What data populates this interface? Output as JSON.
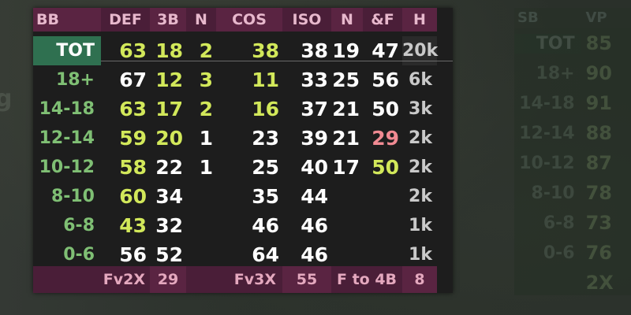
{
  "header": [
    "BB",
    "DEF",
    "3B",
    "N",
    "COS",
    "ISO",
    "N",
    "&F",
    "H"
  ],
  "rows": [
    {
      "label": "TOT",
      "v": [
        {
          "t": "63",
          "c": "y"
        },
        {
          "t": "18",
          "c": "y"
        },
        {
          "t": "2",
          "c": "y"
        },
        {
          "t": "38",
          "c": "y"
        },
        {
          "t": "38",
          "c": "w"
        },
        {
          "t": "19",
          "c": "w"
        },
        {
          "t": "47",
          "c": "w"
        }
      ],
      "h": "20k"
    },
    {
      "label": "18+",
      "v": [
        {
          "t": "67",
          "c": "w"
        },
        {
          "t": "12",
          "c": "y"
        },
        {
          "t": "3",
          "c": "y"
        },
        {
          "t": "11",
          "c": "y"
        },
        {
          "t": "33",
          "c": "w"
        },
        {
          "t": "25",
          "c": "w"
        },
        {
          "t": "56",
          "c": "w"
        }
      ],
      "h": "6k"
    },
    {
      "label": "14-18",
      "v": [
        {
          "t": "63",
          "c": "y"
        },
        {
          "t": "17",
          "c": "y"
        },
        {
          "t": "2",
          "c": "y"
        },
        {
          "t": "16",
          "c": "y"
        },
        {
          "t": "37",
          "c": "w"
        },
        {
          "t": "21",
          "c": "w"
        },
        {
          "t": "50",
          "c": "w"
        }
      ],
      "h": "3k"
    },
    {
      "label": "12-14",
      "v": [
        {
          "t": "59",
          "c": "y"
        },
        {
          "t": "20",
          "c": "y"
        },
        {
          "t": "1",
          "c": "w"
        },
        {
          "t": "23",
          "c": "w"
        },
        {
          "t": "39",
          "c": "w"
        },
        {
          "t": "21",
          "c": "w"
        },
        {
          "t": "29",
          "c": "p"
        }
      ],
      "h": "2k"
    },
    {
      "label": "10-12",
      "v": [
        {
          "t": "58",
          "c": "y"
        },
        {
          "t": "22",
          "c": "w"
        },
        {
          "t": "1",
          "c": "w"
        },
        {
          "t": "25",
          "c": "w"
        },
        {
          "t": "40",
          "c": "w"
        },
        {
          "t": "17",
          "c": "w"
        },
        {
          "t": "50",
          "c": "y"
        }
      ],
      "h": "2k"
    },
    {
      "label": "8-10",
      "v": [
        {
          "t": "60",
          "c": "y"
        },
        {
          "t": "34",
          "c": "w"
        },
        {
          "t": "",
          "c": "w"
        },
        {
          "t": "35",
          "c": "w"
        },
        {
          "t": "44",
          "c": "w"
        },
        {
          "t": "",
          "c": "w"
        },
        {
          "t": "",
          "c": "w"
        }
      ],
      "h": "2k"
    },
    {
      "label": "6-8",
      "v": [
        {
          "t": "43",
          "c": "y"
        },
        {
          "t": "32",
          "c": "w"
        },
        {
          "t": "",
          "c": "w"
        },
        {
          "t": "46",
          "c": "w"
        },
        {
          "t": "46",
          "c": "w"
        },
        {
          "t": "",
          "c": "w"
        },
        {
          "t": "",
          "c": "w"
        }
      ],
      "h": "1k"
    },
    {
      "label": "0-6",
      "v": [
        {
          "t": "56",
          "c": "w"
        },
        {
          "t": "52",
          "c": "w"
        },
        {
          "t": "",
          "c": "w"
        },
        {
          "t": "64",
          "c": "w"
        },
        {
          "t": "46",
          "c": "w"
        },
        {
          "t": "",
          "c": "w"
        },
        {
          "t": "",
          "c": "w"
        }
      ],
      "h": "1k"
    }
  ],
  "footer": {
    "fv2x_label": "Fv2X",
    "fv2x_value": "29",
    "fv3x_label": "Fv3X",
    "fv3x_value": "55",
    "f4b_label": "F to 4B",
    "f4b_value": "8"
  },
  "ghost": {
    "header": [
      "SB",
      "VP"
    ],
    "rows": [
      {
        "label": "TOT",
        "value": "85"
      },
      {
        "label": "18+",
        "value": "90"
      },
      {
        "label": "14-18",
        "value": "91"
      },
      {
        "label": "12-14",
        "value": "88"
      },
      {
        "label": "10-12",
        "value": "87"
      },
      {
        "label": "8-10",
        "value": "78"
      },
      {
        "label": "6-8",
        "value": "73"
      },
      {
        "label": "0-6",
        "value": "76"
      },
      {
        "label": "",
        "value": "2X"
      }
    ]
  },
  "bg_glyph": "g",
  "colors": {
    "header_bg": "#5a2442",
    "tot_bg": "#2f7050",
    "yellow": "#d2e85a",
    "pink": "#f08a92",
    "green": "#7fbf74"
  }
}
